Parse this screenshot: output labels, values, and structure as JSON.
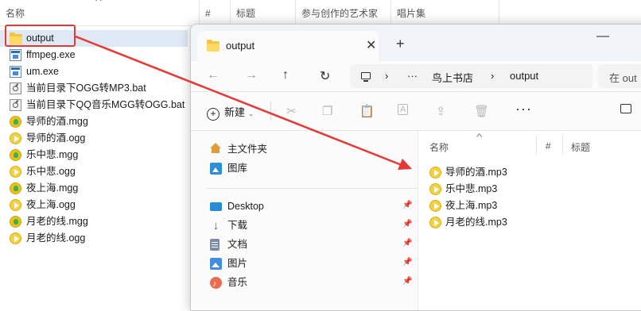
{
  "background_window": {
    "columns": [
      "名称",
      "#",
      "标题",
      "参与创作的艺术家",
      "唱片集"
    ],
    "files": [
      {
        "name": "output",
        "icon": "folder-icon",
        "selected": true
      },
      {
        "name": "ffmpeg.exe",
        "icon": "exe-icon"
      },
      {
        "name": "um.exe",
        "icon": "exe-icon"
      },
      {
        "name": "当前目录下OGG转MP3.bat",
        "icon": "bat-icon"
      },
      {
        "name": "当前目录下QQ音乐MGG转OGG.bat",
        "icon": "bat-icon"
      },
      {
        "name": "导师的酒.mgg",
        "icon": "qq-music-icon"
      },
      {
        "name": "导师的酒.ogg",
        "icon": "audio-play-icon"
      },
      {
        "name": "乐中悲.mgg",
        "icon": "qq-music-icon"
      },
      {
        "name": "乐中悲.ogg",
        "icon": "audio-play-icon"
      },
      {
        "name": "夜上海.mgg",
        "icon": "qq-music-icon"
      },
      {
        "name": "夜上海.ogg",
        "icon": "audio-play-icon"
      },
      {
        "name": "月老的线.mgg",
        "icon": "qq-music-icon"
      },
      {
        "name": "月老的线.ogg",
        "icon": "audio-play-icon"
      }
    ]
  },
  "foreground_window": {
    "tab_title": "output",
    "close_tab_glyph": "✕",
    "new_tab_glyph": "+",
    "minimize_glyph": "—",
    "nav": {
      "back": "←",
      "forward": "→",
      "up": "↑",
      "refresh": "↻"
    },
    "address": {
      "ellipsis": "···",
      "separator": "›",
      "crumbs": [
        "鸟上书店",
        "output"
      ]
    },
    "search_placeholder": "在 out",
    "toolbar": {
      "new_label": "新建",
      "new_caret": "⌄",
      "cut": "✂",
      "copy": "❐",
      "paste": "📋",
      "rename": "A",
      "share": "⇪",
      "delete": "🗑",
      "more": "···"
    },
    "nav_pane": {
      "top": [
        {
          "label": "主文件夹",
          "icon": "home-icon"
        },
        {
          "label": "图库",
          "icon": "gallery-icon"
        }
      ],
      "pinned": [
        {
          "label": "Desktop",
          "icon": "desktop-icon"
        },
        {
          "label": "下载",
          "icon": "download-icon",
          "glyph": "↓"
        },
        {
          "label": "文档",
          "icon": "document-icon"
        },
        {
          "label": "图片",
          "icon": "pictures-icon"
        },
        {
          "label": "音乐",
          "icon": "music-icon"
        }
      ],
      "pin_glyph": "📌"
    },
    "content_columns": [
      "名称",
      "#",
      "标题"
    ],
    "files": [
      {
        "name": "导师的酒.mp3",
        "icon": "audio-play-icon"
      },
      {
        "name": "乐中悲.mp3",
        "icon": "audio-play-icon"
      },
      {
        "name": "夜上海.mp3",
        "icon": "audio-play-icon"
      },
      {
        "name": "月老的线.mp3",
        "icon": "audio-play-icon"
      }
    ]
  },
  "annotation": {
    "highlight_color": "#e53935",
    "arrow_color": "#e53935"
  }
}
